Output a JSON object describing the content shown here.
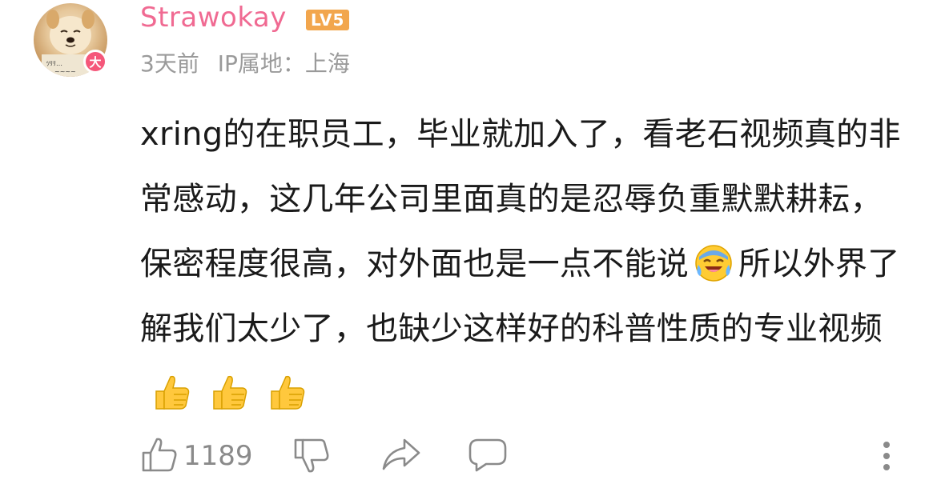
{
  "comment": {
    "username": "Strawokay",
    "level": "LV5",
    "avatar_badge": "大",
    "time": "3天前",
    "ip_location": "IP属地：上海",
    "body_part1": "xring的在职员工，毕业就加入了，看老石视频真的非常感动，这几年公司里面真的是忍辱负重默默耕耘，保密程度很高，对外面也是一点不能说",
    "body_part2": "所以外界了解我们太少了，也缺少这样好的科普性质的专业视频",
    "emoji_after_part1": "laughing-tears-emoji",
    "emojis_end": [
      "thumbs-up-emoji",
      "thumbs-up-emoji",
      "thumbs-up-emoji"
    ],
    "like_count": "1189"
  },
  "icons": [
    "like-icon",
    "dislike-icon",
    "share-icon",
    "reply-icon",
    "more-icon"
  ],
  "colors": {
    "username": "#f06a92",
    "level_badge": "#f2a64d",
    "avatar_badge": "#f5577a",
    "meta_text": "#9a9a9a",
    "action_icons": "#8a8a8a"
  }
}
